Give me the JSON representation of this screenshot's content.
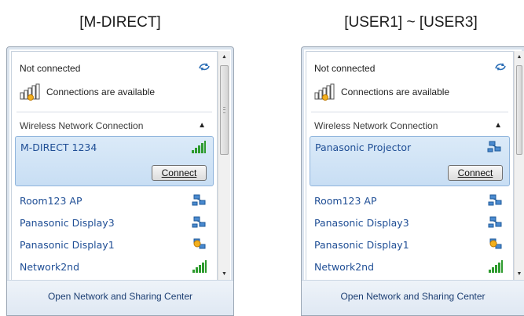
{
  "captions": {
    "left": "[M-DIRECT]",
    "right": "[USER1] ~ [USER3]"
  },
  "panels": [
    {
      "id": "left",
      "status": "Not connected",
      "connections": "Connections are available",
      "section": "Wireless Network Connection",
      "selected_network": {
        "name": "M-DIRECT 1234",
        "icon": "wifi-signal-icon"
      },
      "connect_label": "Connect",
      "networks": [
        {
          "name": "Room123 AP",
          "icon": "adhoc-network-icon"
        },
        {
          "name": "Panasonic Display3",
          "icon": "adhoc-network-icon"
        },
        {
          "name": "Panasonic Display1",
          "icon": "adhoc-network-warning-icon"
        },
        {
          "name": "Network2nd",
          "icon": "wifi-signal-icon"
        }
      ],
      "footer": "Open Network and Sharing Center"
    },
    {
      "id": "right",
      "status": "Not connected",
      "connections": "Connections are available",
      "section": "Wireless Network Connection",
      "selected_network": {
        "name": "Panasonic Projector",
        "icon": "adhoc-network-icon"
      },
      "connect_label": "Connect",
      "networks": [
        {
          "name": "Room123 AP",
          "icon": "adhoc-network-icon"
        },
        {
          "name": "Panasonic Display3",
          "icon": "adhoc-network-icon"
        },
        {
          "name": "Panasonic Display1",
          "icon": "adhoc-network-warning-icon"
        },
        {
          "name": "Network2nd",
          "icon": "wifi-signal-icon"
        }
      ],
      "footer": "Open Network and Sharing Center"
    }
  ],
  "colors": {
    "link": "#1f4e95",
    "selected_bg": "#c8def4",
    "selected_border": "#8fb4dc",
    "footer_bg": "#e6edf6"
  }
}
